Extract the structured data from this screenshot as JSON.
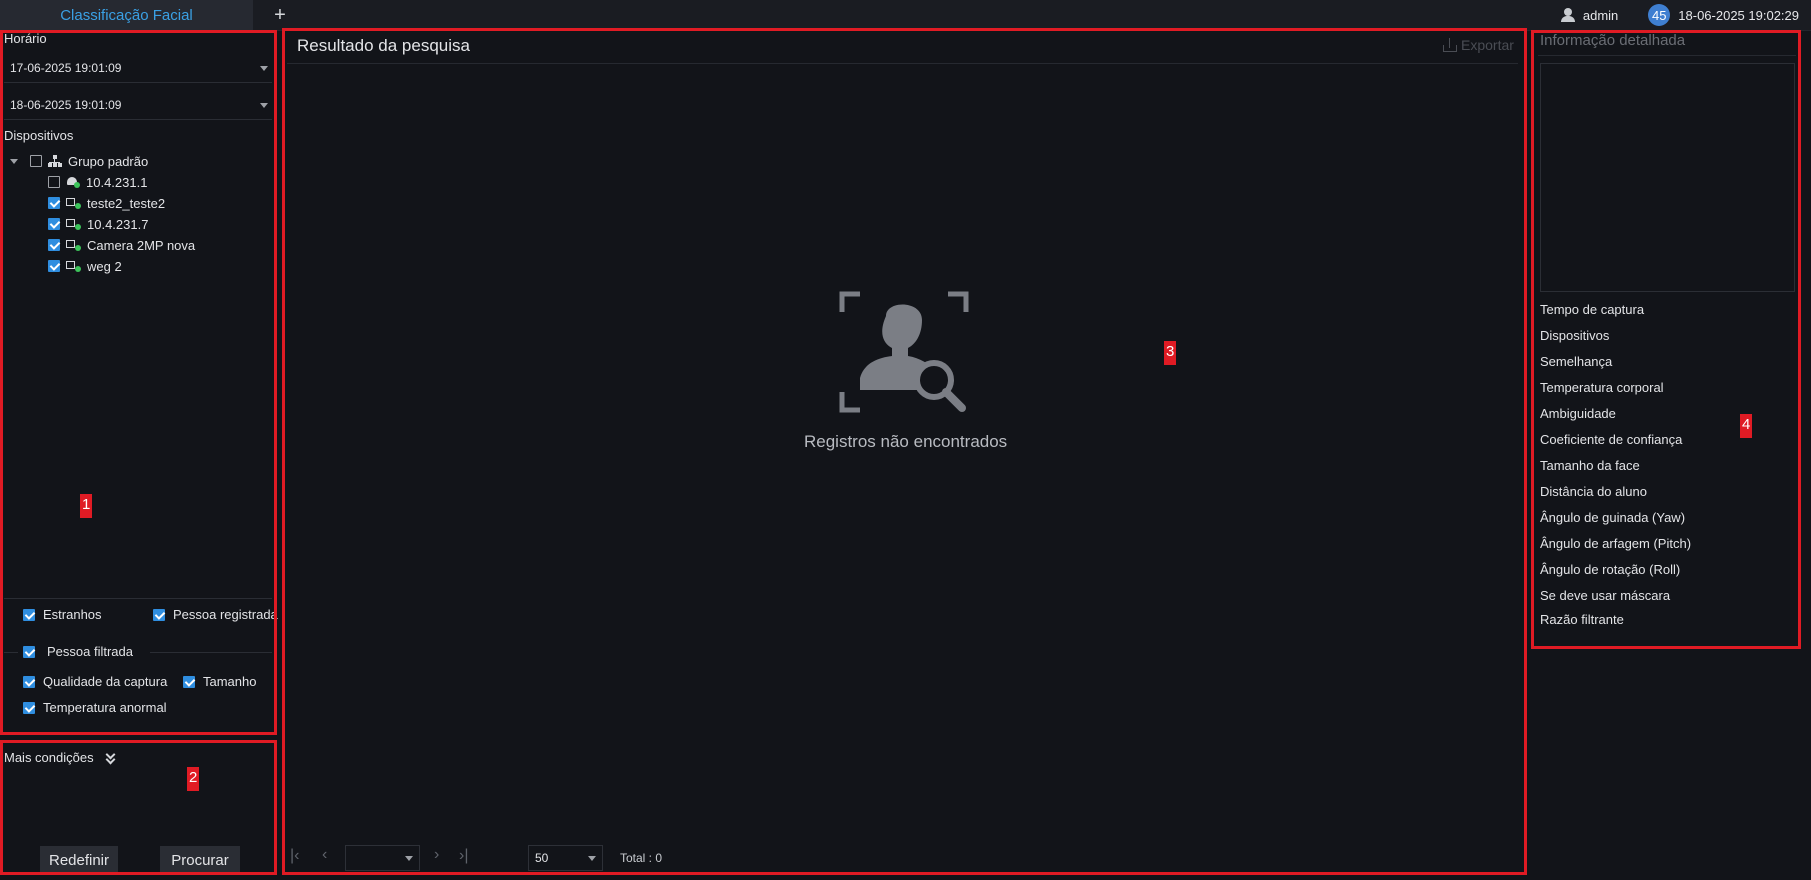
{
  "topbar": {
    "tab_title": "Classificação Facial",
    "add_tab": "+",
    "user": "admin",
    "badge_count": "45",
    "datetime": "18-06-2025 19:02:29"
  },
  "left": {
    "time_label": "Horário",
    "start_time": "17-06-2025 19:01:09",
    "end_time": "18-06-2025 19:01:09",
    "devices_label": "Dispositivos",
    "group_name": "Grupo padrão",
    "devices": [
      {
        "name": "10.4.231.1",
        "checked": false,
        "icon": "dome-camera-icon"
      },
      {
        "name": "teste2_teste2",
        "checked": true,
        "icon": "camera-icon"
      },
      {
        "name": "10.4.231.7",
        "checked": true,
        "icon": "camera-icon"
      },
      {
        "name": "Camera 2MP nova",
        "checked": true,
        "icon": "camera-icon"
      },
      {
        "name": "weg 2",
        "checked": true,
        "icon": "camera-icon"
      }
    ],
    "options": {
      "strangers": "Estranhos",
      "registered": "Pessoa registrada",
      "filtered": "Pessoa filtrada",
      "capture_quality": "Qualidade da captura",
      "size": "Tamanho",
      "abnormal_temp": "Temperatura anormal"
    },
    "more_conditions": "Mais condições",
    "reset_button": "Redefinir",
    "search_button": "Procurar"
  },
  "center": {
    "title": "Resultado da pesquisa",
    "export": "Exportar",
    "empty_message": "Registros não encontrados",
    "page_size": "50",
    "total": "Total : 0"
  },
  "right": {
    "title": "Informação detalhada",
    "fields": [
      "Tempo de captura",
      "Dispositivos",
      "Semelhança",
      "Temperatura corporal",
      "Ambiguidade",
      "Coeficiente de confiança",
      "Tamanho da face",
      "Distância do aluno",
      "Ângulo de guinada (Yaw)",
      "Ângulo de arfagem (Pitch)",
      "Ângulo de rotação (Roll)",
      "Se deve usar máscara",
      "Razão filtrante"
    ]
  },
  "markers": [
    "1",
    "2",
    "3",
    "4"
  ],
  "colors": {
    "accent": "#3aa0e4",
    "highlight_box": "#e01b24",
    "checkbox": "#2f8ee0",
    "online": "#3cc35a"
  }
}
